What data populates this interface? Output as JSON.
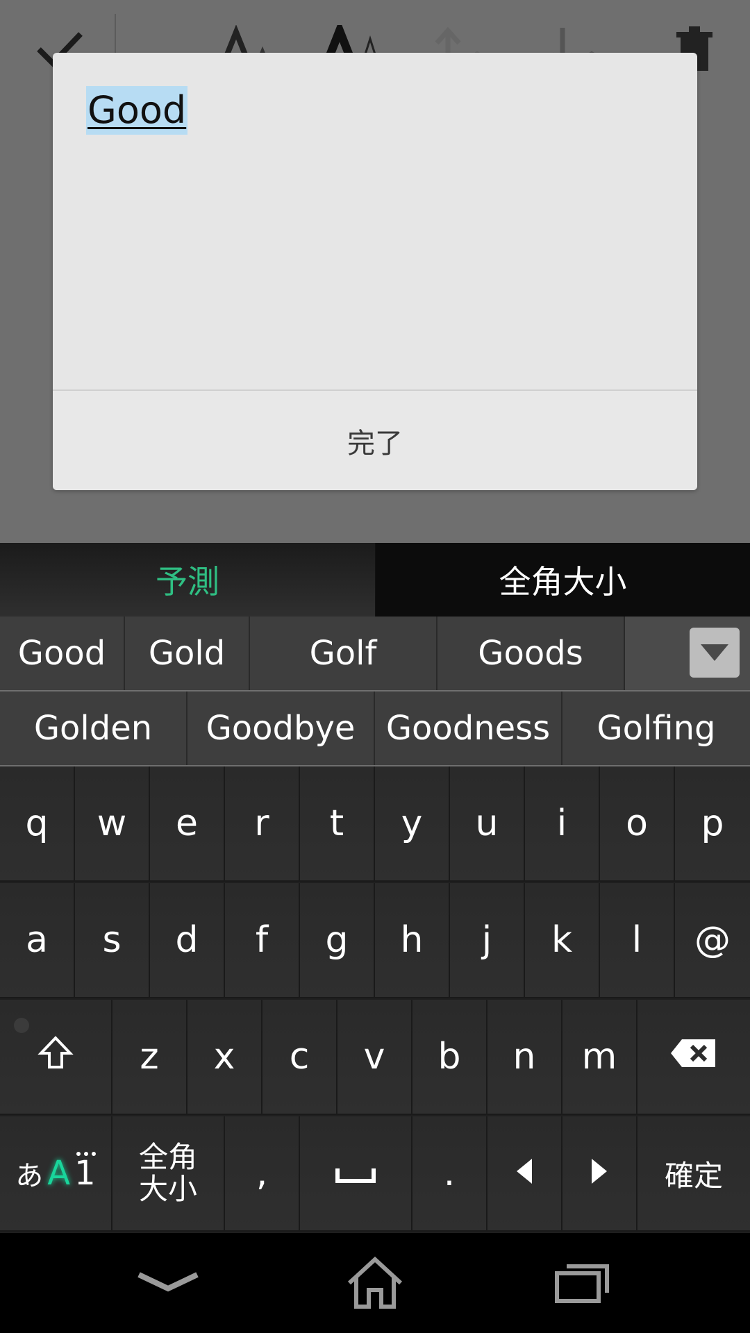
{
  "toolbar": {
    "check_icon": "check-icon",
    "font_small_icon": "font-small-icon",
    "font_large_icon": "font-large-icon",
    "move_up_icon": "layer-up-icon",
    "move_down_icon": "layer-down-icon",
    "trash_icon": "trash-icon"
  },
  "dialog": {
    "text": "Good",
    "done_label": "完了"
  },
  "keyboard": {
    "tabs": [
      "予測",
      "全角大小"
    ],
    "candidates_row1": [
      "Good",
      "Gold",
      "Golf",
      "Goods"
    ],
    "candidates_row2": [
      "Golden",
      "Goodbye",
      "Goodness",
      "Golfing"
    ],
    "row1": [
      "q",
      "w",
      "e",
      "r",
      "t",
      "y",
      "u",
      "i",
      "o",
      "p"
    ],
    "row2": [
      "a",
      "s",
      "d",
      "f",
      "g",
      "h",
      "j",
      "k",
      "l",
      "@"
    ],
    "row3": [
      "z",
      "x",
      "c",
      "v",
      "b",
      "n",
      "m"
    ],
    "bottom": {
      "mode_kana": "あ",
      "mode_a": "A",
      "mode_one": "1",
      "zenkaku_top": "全角",
      "zenkaku_bottom": "大小",
      "comma": ",",
      "period": ".",
      "confirm": "確定"
    }
  }
}
